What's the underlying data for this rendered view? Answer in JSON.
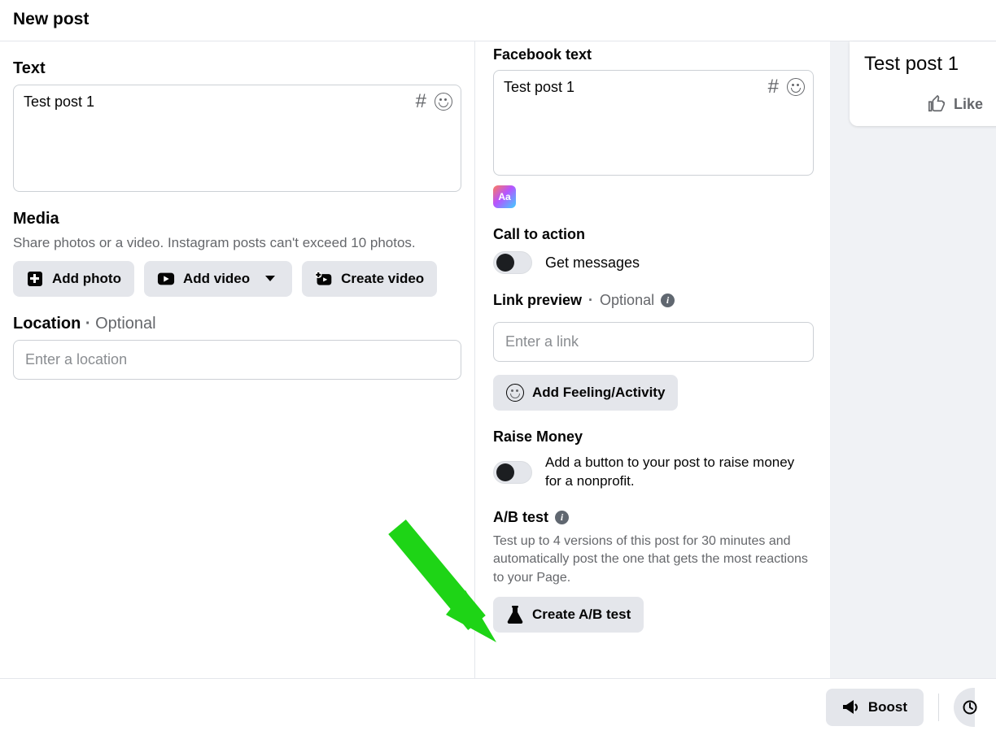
{
  "header": {
    "title": "New post"
  },
  "left": {
    "text_label": "Text",
    "text_value": "Test post 1",
    "media_label": "Media",
    "media_sub": "Share photos or a video. Instagram posts can't exceed 10 photos.",
    "add_photo": "Add photo",
    "add_video": "Add video",
    "create_video": "Create video",
    "location_label": "Location",
    "location_optional": "Optional",
    "location_placeholder": "Enter a location"
  },
  "mid": {
    "fb_text_label": "Facebook text",
    "fb_text_value": "Test post 1",
    "aa_badge": "Aa",
    "cta_label": "Call to action",
    "cta_value": "Get messages",
    "link_label": "Link preview",
    "link_optional": "Optional",
    "link_placeholder": "Enter a link",
    "feeling_label": "Add Feeling/Activity",
    "raise_label": "Raise Money",
    "raise_desc": "Add a button to your post to raise money for a nonprofit.",
    "abtest_label": "A/B test",
    "abtest_desc": "Test up to 4 versions of this post for 30 minutes and automatically post the one that gets the most reactions to your Page.",
    "abtest_button": "Create A/B test"
  },
  "preview": {
    "text": "Test post 1",
    "like": "Like"
  },
  "footer": {
    "boost": "Boost"
  }
}
